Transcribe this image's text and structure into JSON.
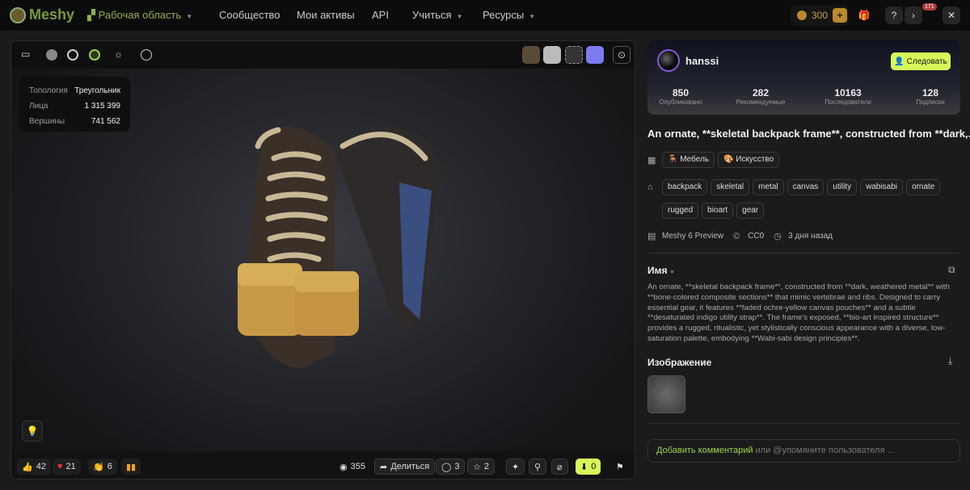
{
  "nav": {
    "logo": "Meshy",
    "workspace": "Рабочая область",
    "community": "Сообщество",
    "assets": "Мои активы",
    "api": "API",
    "learn": "Учиться",
    "resources": "Ресурсы",
    "credits": "300",
    "notifications": "171"
  },
  "viewer": {
    "stats": [
      {
        "k": "Топология",
        "v": "Треугольник"
      },
      {
        "k": "Лица",
        "v": "1 315 399"
      },
      {
        "k": "Вершины",
        "v": "741 562"
      }
    ],
    "reactions": {
      "likes": "42",
      "hearts": "21",
      "claps": "6"
    },
    "views": "355",
    "share": "Делиться",
    "comments": "3",
    "stars": "2",
    "downloads": "0"
  },
  "profile": {
    "name": "hanssi",
    "follow": "Следовать",
    "stats": [
      {
        "n": "850",
        "l": "Опубликовано"
      },
      {
        "n": "282",
        "l": "Рекомендуемые"
      },
      {
        "n": "10163",
        "l": "Последователи"
      },
      {
        "n": "128",
        "l": "Подписки"
      }
    ]
  },
  "model": {
    "title": "An ornate, **skeletal backpack frame**, constructed from **dark,...",
    "categories": [
      "Мебель",
      "Искусство"
    ],
    "tags": [
      "backpack",
      "skeletal",
      "metal",
      "canvas",
      "utility",
      "wabisabi",
      "ornate",
      "rugged",
      "bioart",
      "gear"
    ],
    "engine": "Meshy 6 Preview",
    "license": "CC0",
    "time": "3 дня назад",
    "name_label": "Имя",
    "description": "An ornate, **skeletal backpack frame**, constructed from **dark, weathered metal** with **bone-colored composite sections** that mimic vertebrae and ribs. Designed to carry essential gear, it features **faded ochre-yellow canvas pouches** and a subtle **desaturated indigo utility strap**. The frame's exposed, **bio-art inspired structure** provides a rugged, ritualistic, yet stylistically conscious appearance with a diverse, low-saturation palette, embodying **Wabi-sabi design principles**.",
    "image_label": "Изображение",
    "comment_action": "Добавить комментарий",
    "comment_rest": " или @упомяните пользователя ..."
  }
}
